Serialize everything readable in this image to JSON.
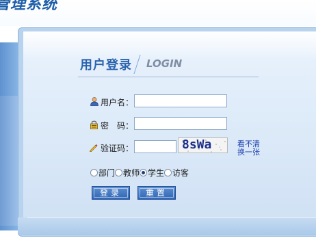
{
  "app": {
    "title": "管理系统"
  },
  "login": {
    "title": "用户登录",
    "subtitle": "LOGIN",
    "username_label": "用户名：",
    "username_value": "",
    "password_label": "密　码：",
    "password_value": "",
    "captcha_label": "验证码：",
    "captcha_value": "",
    "captcha_image_text": "8sWa",
    "refresh_link_line1": "看不清",
    "refresh_link_line2": "换一张"
  },
  "roles": {
    "options": [
      "部门",
      "教师",
      "学生",
      "访客"
    ],
    "selected": "学生"
  },
  "buttons": {
    "login": "登录",
    "reset": "重置"
  },
  "colors": {
    "accent": "#2a63ad",
    "button": "#2f66b6",
    "link": "#1a3fb0"
  },
  "icons": {
    "username": "user-icon",
    "password": "lock-icon",
    "captcha": "pencil-icon"
  }
}
